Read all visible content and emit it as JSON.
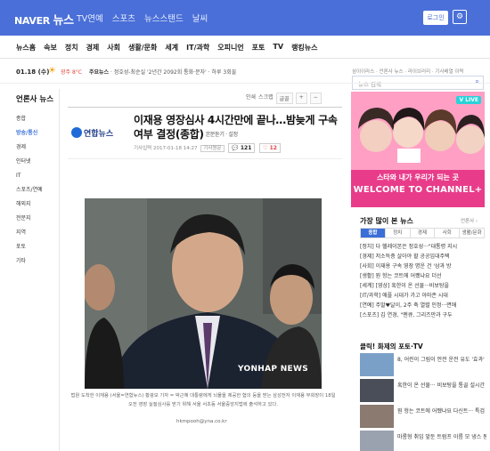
{
  "header": {
    "logo": "NAVER",
    "logo_section": "뉴스",
    "nav": [
      "TV연예",
      "스포츠",
      "뉴스스탠드",
      "날씨"
    ],
    "login_label": "로그인",
    "settings_icon": "gear-icon"
  },
  "categories": [
    "뉴스홈",
    "속보",
    "정치",
    "경제",
    "사회",
    "생활/문화",
    "세계",
    "IT/과학",
    "오피니언",
    "포토",
    "TV",
    "랭킹뉴스"
  ],
  "search": {
    "placeholder": "뉴스 검색",
    "icon": "search-icon"
  },
  "ticker": {
    "date": "01.18 (수)",
    "weather_icon": "sun-icon",
    "weather": "광주",
    "temperature": "8°C",
    "headline_label": "주요뉴스",
    "headline": "정호성-최순실 '2년간 2092회 통화·문자' · 하루 3회꼴",
    "links": "삼이이라스 · 언론사 뉴스 · 라이브러리 · 기사배열 이력"
  },
  "left_sidebar": {
    "title": "언론사 뉴스",
    "items": [
      "종합",
      "방송/통신",
      "경제",
      "인터넷",
      "IT",
      "스포츠/연예",
      "해외지",
      "전문지",
      "지역",
      "포토",
      "기타"
    ],
    "active_index": 1
  },
  "article": {
    "tools": [
      "인쇄",
      "스크랩",
      "글꼴",
      "+",
      "−"
    ],
    "source": "연합뉴스",
    "title": "이재용 영장심사 4시간만에 끝나…밤늦게 구속여부 결정(종합)",
    "title_tags": "본문듣기 · 설정",
    "meta": {
      "date": "기사입력 2017-01-18 14:27",
      "original": "기사원문",
      "comments": "121",
      "likes": "12"
    },
    "watermark": "YONHAP NEWS",
    "caption": "법원 도착한 이재용 (서울=연합뉴스) 황광모 기자 = 박근혜 대통령에게 뇌물을 제공한 혐의 등을 받는 삼성전자 이재용 부회장이 18일 오전 영장 실질심사를 받기 위해 서울 서초동 서울중앙지법에 출석하고 있다.",
    "email": "hkmpooh@yna.co.kr"
  },
  "ad": {
    "badge": "V LIVE",
    "line1": "스타와 내가 우리가 되는 곳",
    "line2": "WELCOME TO CHANNEL+"
  },
  "right": {
    "heading": "가장 많이 본 뉴스",
    "heading_link": "언론사 ›",
    "tabs": [
      "종합",
      "정치",
      "경제",
      "사회",
      "생활/문화"
    ],
    "active_tab": 0,
    "news": [
      "[정치] 다 헬레이본은 정호성···\"대통령 지시",
      "[경제] 저소득층 살아야 할 공공임대주택",
      "[사회] 이재용 구속 영장 명운 건 '삼과 방",
      "[생활] 뭔 헝는 코트에 어쨌냐요 더선",
      "[세계] [영상] 혹한이 온 선물···비보탕을",
      "[IT/과학] 애플 시대가 가고 아마존 시대",
      "[연예] 주말♥달이, 2주 축 열렬 인정···면애",
      "[스포츠] 김 연경, \"멘큐, 그리즈만과 구두"
    ],
    "photo_heading": "클릭! 화제의 포토·TV",
    "photos": [
      "8, 어린이 그림이 안전 운전 유도 '효과'",
      "혹한이 온 선물··· 비보탕을 통골 설시간 촬영",
      "뭔 헝는 코트에 어쨌냐요 다신트··· 특검 대면인, 헝 찰",
      "마롱형 취임 앞둔 트럼프 이름 모 냉스 동장···'공범꺼리' 특강"
    ]
  }
}
